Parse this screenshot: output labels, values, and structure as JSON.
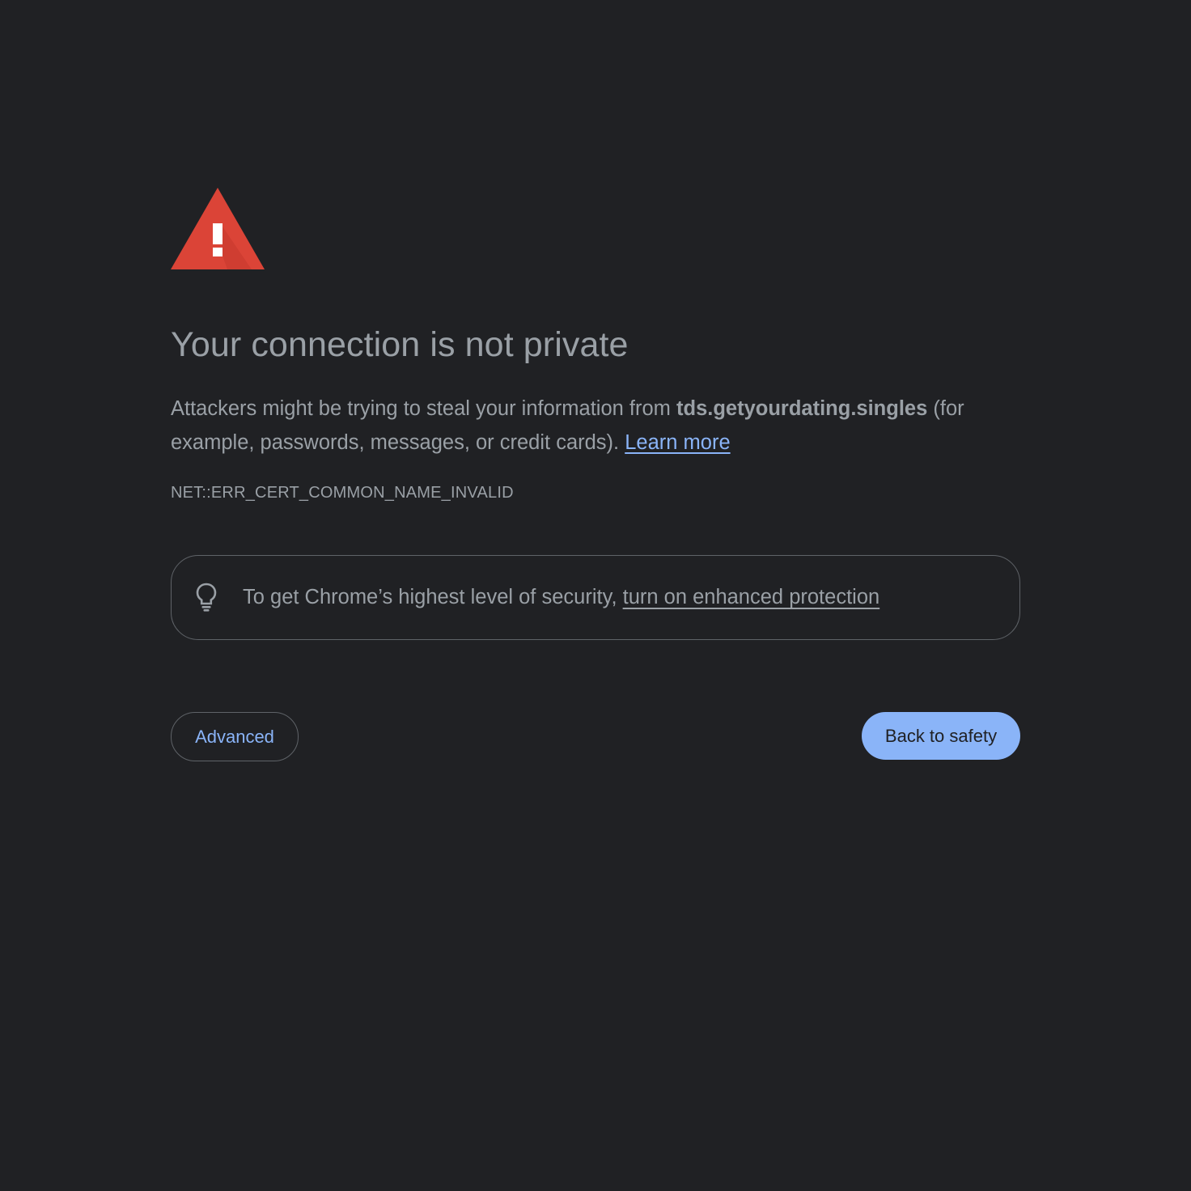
{
  "page": {
    "background": "#202124",
    "accent": "#8ab4f8",
    "warning_color": "#db4437"
  },
  "icon": {
    "warning": "warning-triangle-icon",
    "tip": "lightbulb-icon"
  },
  "title": "Your connection is not private",
  "message": {
    "prefix": "Attackers might be trying to steal your information from ",
    "host": "tds.getyourdating.singles",
    "suffix": " (for example, passwords, messages, or credit cards). ",
    "learn_more": "Learn more"
  },
  "error_code": "NET::ERR_CERT_COMMON_NAME_INVALID",
  "enhanced": {
    "text": "To get Chrome’s highest level of security, ",
    "link": "turn on enhanced protection"
  },
  "buttons": {
    "advanced": "Advanced",
    "back": "Back to safety"
  }
}
